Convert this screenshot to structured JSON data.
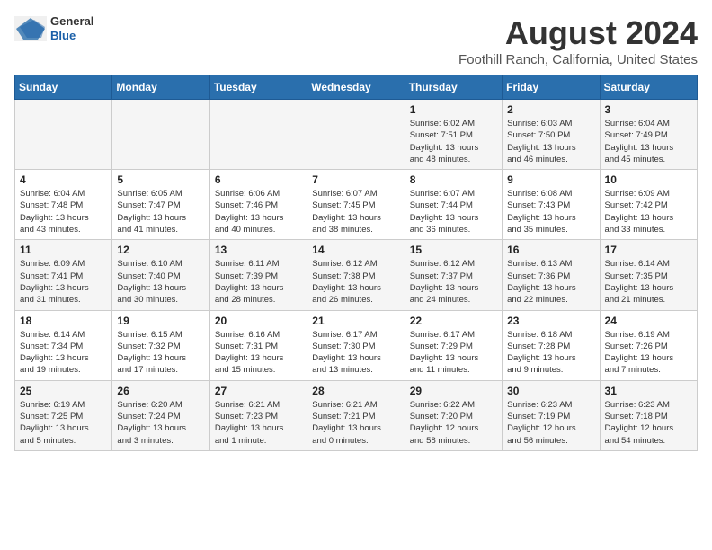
{
  "header": {
    "logo_line1": "General",
    "logo_line2": "Blue",
    "main_title": "August 2024",
    "subtitle": "Foothill Ranch, California, United States"
  },
  "days_of_week": [
    "Sunday",
    "Monday",
    "Tuesday",
    "Wednesday",
    "Thursday",
    "Friday",
    "Saturday"
  ],
  "weeks": [
    {
      "days": [
        {
          "number": "",
          "info": ""
        },
        {
          "number": "",
          "info": ""
        },
        {
          "number": "",
          "info": ""
        },
        {
          "number": "",
          "info": ""
        },
        {
          "number": "1",
          "info": "Sunrise: 6:02 AM\nSunset: 7:51 PM\nDaylight: 13 hours\nand 48 minutes."
        },
        {
          "number": "2",
          "info": "Sunrise: 6:03 AM\nSunset: 7:50 PM\nDaylight: 13 hours\nand 46 minutes."
        },
        {
          "number": "3",
          "info": "Sunrise: 6:04 AM\nSunset: 7:49 PM\nDaylight: 13 hours\nand 45 minutes."
        }
      ]
    },
    {
      "days": [
        {
          "number": "4",
          "info": "Sunrise: 6:04 AM\nSunset: 7:48 PM\nDaylight: 13 hours\nand 43 minutes."
        },
        {
          "number": "5",
          "info": "Sunrise: 6:05 AM\nSunset: 7:47 PM\nDaylight: 13 hours\nand 41 minutes."
        },
        {
          "number": "6",
          "info": "Sunrise: 6:06 AM\nSunset: 7:46 PM\nDaylight: 13 hours\nand 40 minutes."
        },
        {
          "number": "7",
          "info": "Sunrise: 6:07 AM\nSunset: 7:45 PM\nDaylight: 13 hours\nand 38 minutes."
        },
        {
          "number": "8",
          "info": "Sunrise: 6:07 AM\nSunset: 7:44 PM\nDaylight: 13 hours\nand 36 minutes."
        },
        {
          "number": "9",
          "info": "Sunrise: 6:08 AM\nSunset: 7:43 PM\nDaylight: 13 hours\nand 35 minutes."
        },
        {
          "number": "10",
          "info": "Sunrise: 6:09 AM\nSunset: 7:42 PM\nDaylight: 13 hours\nand 33 minutes."
        }
      ]
    },
    {
      "days": [
        {
          "number": "11",
          "info": "Sunrise: 6:09 AM\nSunset: 7:41 PM\nDaylight: 13 hours\nand 31 minutes."
        },
        {
          "number": "12",
          "info": "Sunrise: 6:10 AM\nSunset: 7:40 PM\nDaylight: 13 hours\nand 30 minutes."
        },
        {
          "number": "13",
          "info": "Sunrise: 6:11 AM\nSunset: 7:39 PM\nDaylight: 13 hours\nand 28 minutes."
        },
        {
          "number": "14",
          "info": "Sunrise: 6:12 AM\nSunset: 7:38 PM\nDaylight: 13 hours\nand 26 minutes."
        },
        {
          "number": "15",
          "info": "Sunrise: 6:12 AM\nSunset: 7:37 PM\nDaylight: 13 hours\nand 24 minutes."
        },
        {
          "number": "16",
          "info": "Sunrise: 6:13 AM\nSunset: 7:36 PM\nDaylight: 13 hours\nand 22 minutes."
        },
        {
          "number": "17",
          "info": "Sunrise: 6:14 AM\nSunset: 7:35 PM\nDaylight: 13 hours\nand 21 minutes."
        }
      ]
    },
    {
      "days": [
        {
          "number": "18",
          "info": "Sunrise: 6:14 AM\nSunset: 7:34 PM\nDaylight: 13 hours\nand 19 minutes."
        },
        {
          "number": "19",
          "info": "Sunrise: 6:15 AM\nSunset: 7:32 PM\nDaylight: 13 hours\nand 17 minutes."
        },
        {
          "number": "20",
          "info": "Sunrise: 6:16 AM\nSunset: 7:31 PM\nDaylight: 13 hours\nand 15 minutes."
        },
        {
          "number": "21",
          "info": "Sunrise: 6:17 AM\nSunset: 7:30 PM\nDaylight: 13 hours\nand 13 minutes."
        },
        {
          "number": "22",
          "info": "Sunrise: 6:17 AM\nSunset: 7:29 PM\nDaylight: 13 hours\nand 11 minutes."
        },
        {
          "number": "23",
          "info": "Sunrise: 6:18 AM\nSunset: 7:28 PM\nDaylight: 13 hours\nand 9 minutes."
        },
        {
          "number": "24",
          "info": "Sunrise: 6:19 AM\nSunset: 7:26 PM\nDaylight: 13 hours\nand 7 minutes."
        }
      ]
    },
    {
      "days": [
        {
          "number": "25",
          "info": "Sunrise: 6:19 AM\nSunset: 7:25 PM\nDaylight: 13 hours\nand 5 minutes."
        },
        {
          "number": "26",
          "info": "Sunrise: 6:20 AM\nSunset: 7:24 PM\nDaylight: 13 hours\nand 3 minutes."
        },
        {
          "number": "27",
          "info": "Sunrise: 6:21 AM\nSunset: 7:23 PM\nDaylight: 13 hours\nand 1 minute."
        },
        {
          "number": "28",
          "info": "Sunrise: 6:21 AM\nSunset: 7:21 PM\nDaylight: 13 hours\nand 0 minutes."
        },
        {
          "number": "29",
          "info": "Sunrise: 6:22 AM\nSunset: 7:20 PM\nDaylight: 12 hours\nand 58 minutes."
        },
        {
          "number": "30",
          "info": "Sunrise: 6:23 AM\nSunset: 7:19 PM\nDaylight: 12 hours\nand 56 minutes."
        },
        {
          "number": "31",
          "info": "Sunrise: 6:23 AM\nSunset: 7:18 PM\nDaylight: 12 hours\nand 54 minutes."
        }
      ]
    }
  ]
}
